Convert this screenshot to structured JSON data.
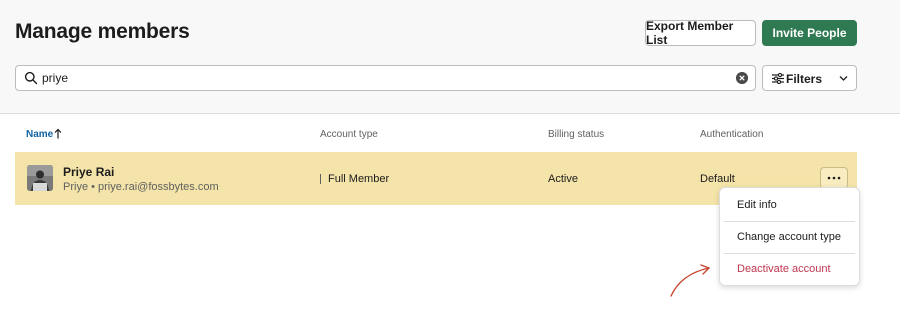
{
  "header": {
    "title": "Manage members",
    "export_label": "Export Member List",
    "invite_label": "Invite People"
  },
  "search": {
    "value": "priye",
    "placeholder": ""
  },
  "filters": {
    "label": "Filters"
  },
  "table": {
    "columns": [
      "Name",
      "Account type",
      "Billing status",
      "Authentication"
    ],
    "sort_column": "Name",
    "sort_direction": "ascending",
    "rows": [
      {
        "name": "Priye Rai",
        "subtitle": "Priye • priye.rai@fossbytes.com",
        "account_type": "Full Member",
        "billing_status": "Active",
        "authentication": "Default"
      }
    ]
  },
  "row_menu": {
    "items": [
      "Edit info",
      "Change account type",
      "Deactivate account"
    ]
  },
  "colors": {
    "accent_green": "#2f7a52",
    "row_highlight": "#f4e4a9",
    "link_blue": "#1264a3",
    "danger_red": "#c0364f"
  },
  "icons": [
    "search-icon",
    "clear-icon",
    "filters-icon",
    "chevron-down-icon",
    "sort-arrow-icon",
    "more-horizontal-icon",
    "avatar-image"
  ]
}
